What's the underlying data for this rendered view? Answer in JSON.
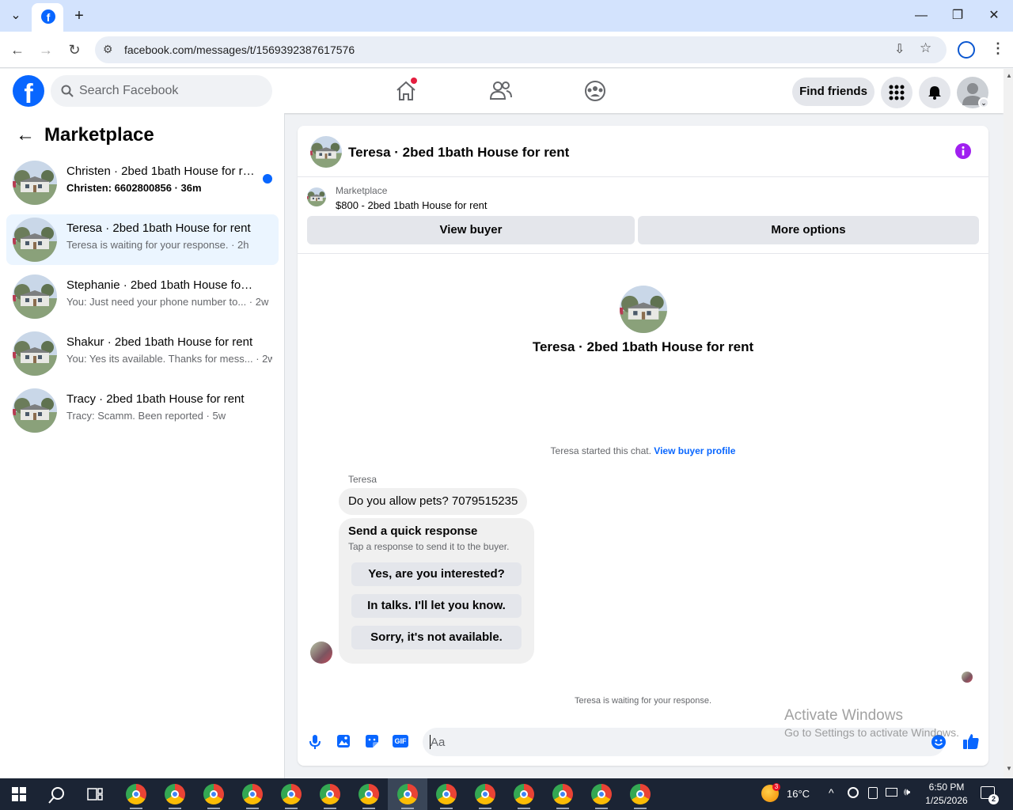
{
  "browser": {
    "url": "facebook.com/messages/t/1569392387617576",
    "new_tab": "+",
    "tab_icon": "f"
  },
  "header": {
    "logo": "f",
    "search_placeholder": "Search Facebook",
    "find_friends": "Find friends"
  },
  "sidebar": {
    "title": "Marketplace",
    "conversations": [
      {
        "title": "Christen · 2bed 1bath House for rent",
        "subtitle": "Christen: 6602800856 · 36m",
        "unread": true
      },
      {
        "title": "Teresa · 2bed 1bath House for rent",
        "subtitle": "Teresa is waiting for your response. · 2h",
        "unread": false
      },
      {
        "title": "Stephanie · 2bed 1bath House for rent",
        "subtitle": "You: Just need your phone number to... · 2w",
        "unread": false
      },
      {
        "title": "Shakur · 2bed 1bath House for rent",
        "subtitle": "You: Yes its available. Thanks for mess... · 2w",
        "unread": false
      },
      {
        "title": "Tracy · 2bed 1bath House for rent",
        "subtitle": "Tracy: Scamm. Been reported · 5w",
        "unread": false
      }
    ]
  },
  "chat": {
    "title": "Teresa · 2bed 1bath House for rent",
    "listing_label": "Marketplace",
    "listing_title": "$800 - 2bed 1bath House for rent",
    "view_buyer": "View buyer",
    "more_options": "More options",
    "intro_name": "Teresa · 2bed 1bath House for rent",
    "started_text": "Teresa started this chat.",
    "started_link": "View buyer profile",
    "sender": "Teresa",
    "message": "Do you allow pets? 7079515235",
    "quick_title": "Send a quick response",
    "quick_subtitle": "Tap a response to send it to the buyer.",
    "quick_replies": [
      "Yes, are you interested?",
      "In talks. I'll let you know.",
      "Sorry, it's not available."
    ],
    "waiting": "Teresa is waiting for your response.",
    "input_placeholder": "Aa",
    "gif_label": "GIF"
  },
  "watermark": {
    "line1": "Activate Windows",
    "line2": "Go to Settings to activate Windows."
  },
  "taskbar": {
    "temperature": "16°C",
    "weather_badge": "3",
    "time": "6:50 PM",
    "date": "1/25/2026",
    "notifications": "2"
  },
  "colors": {
    "fb_blue": "#0866ff",
    "active_row": "#ebf5ff",
    "info_icon": "#a020f0",
    "notification_dot": "#e41e3f"
  }
}
